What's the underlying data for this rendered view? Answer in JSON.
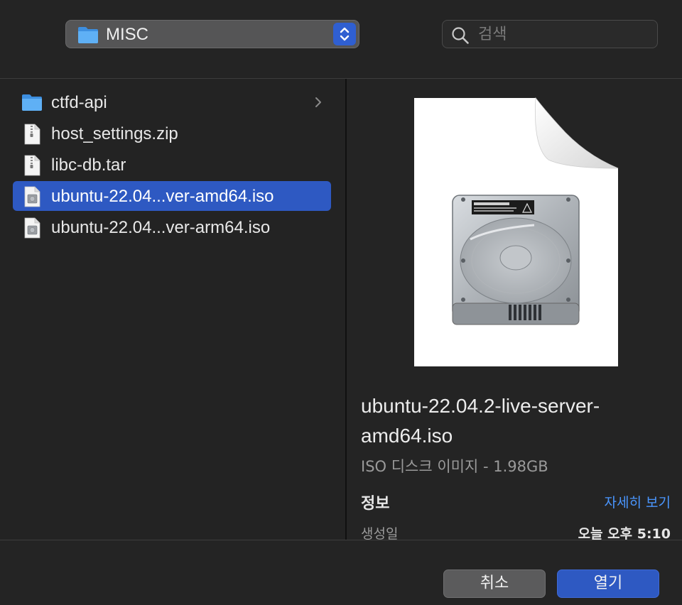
{
  "toolbar": {
    "location": {
      "label": "MISC",
      "icon": "folder-icon"
    },
    "search": {
      "placeholder": "검색",
      "value": ""
    }
  },
  "files": [
    {
      "name": "ctfd-api",
      "type": "folder",
      "icon": "folder-icon",
      "has_children": true,
      "selected": false
    },
    {
      "name": "host_settings.zip",
      "type": "zip",
      "icon": "zip-file-icon",
      "selected": false
    },
    {
      "name": "libc-db.tar",
      "type": "tar",
      "icon": "tar-file-icon",
      "selected": false
    },
    {
      "name": "ubuntu-22.04...ver-amd64.iso",
      "type": "iso",
      "icon": "disk-image-icon",
      "selected": true
    },
    {
      "name": "ubuntu-22.04...ver-arm64.iso",
      "type": "iso",
      "icon": "disk-image-icon",
      "selected": false
    }
  ],
  "preview": {
    "icon": "hard-disk-image-icon",
    "file_name": "ubuntu-22.04.2-live-server-amd64.iso",
    "kind_size": "ISO 디스크 이미지 - 1.98GB",
    "info_title": "정보",
    "show_more": "자세히 보기",
    "created_label": "생성일",
    "created_value": "오늘 오후 5:10"
  },
  "buttons": {
    "cancel": "취소",
    "open": "열기"
  },
  "colors": {
    "accent": "#2e59c2",
    "link": "#4a96ff",
    "background": "#232323"
  }
}
